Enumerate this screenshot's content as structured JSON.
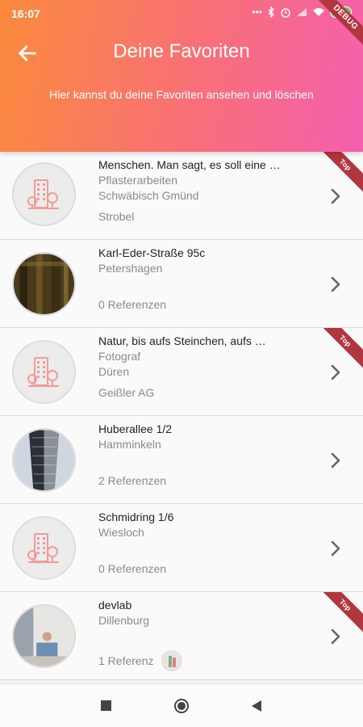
{
  "status_bar": {
    "time": "16:07",
    "battery": "100"
  },
  "debug_banner": "DEBUG",
  "header": {
    "title": "Deine Favoriten",
    "subtitle": "Hier kannst du deine Favoriten ansehen und löschen"
  },
  "ribbon_label": "Top",
  "favorites": [
    {
      "line1": "Menschen. Man sagt, es soll eine …",
      "line2": "Pflasterarbeiten",
      "line3": "Schwäbisch Gmünd",
      "reference": "Strobel",
      "avatar": "building-placeholder-icon",
      "top": true
    },
    {
      "line1": "Karl-Eder-Straße 95c",
      "line2": "Petershagen",
      "line3": "",
      "reference": "0 Referenzen",
      "avatar": "photo-dark-wood",
      "top": false
    },
    {
      "line1": "Natur, bis aufs Steinchen, aufs …",
      "line2": "Fotograf",
      "line3": "Düren",
      "reference": "Geißler AG",
      "avatar": "building-placeholder-icon",
      "top": true
    },
    {
      "line1": "Huberallee 1/2",
      "line2": "Hamminkeln",
      "line3": "",
      "reference": "2 Referenzen",
      "avatar": "photo-building",
      "top": false
    },
    {
      "line1": "Schmidring 1/6",
      "line2": "Wiesloch",
      "line3": "",
      "reference": "0 Referenzen",
      "avatar": "building-placeholder-icon",
      "top": false
    },
    {
      "line1": "devlab",
      "line2": "Dillenburg",
      "line3": "",
      "reference": "1 Referenz",
      "avatar": "photo-room",
      "top": true
    }
  ],
  "colors": {
    "header_start": "#fb8a3c",
    "header_end": "#f55fb0",
    "ribbon": "#b0373e",
    "placeholder": "#f39a9a"
  }
}
